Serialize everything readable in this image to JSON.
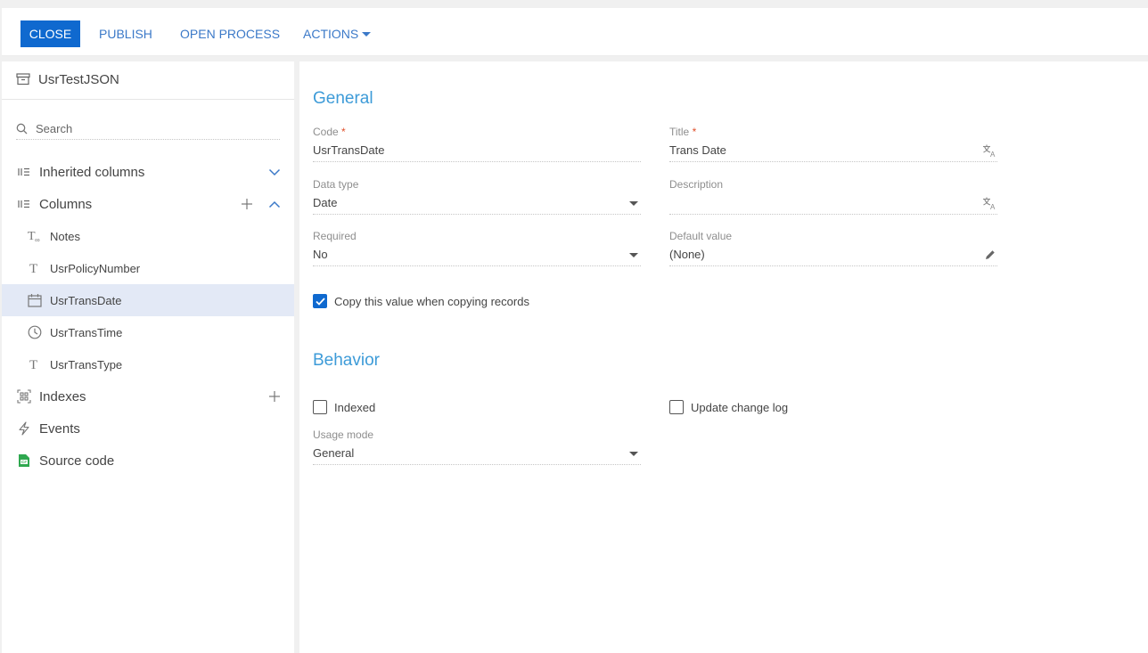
{
  "toolbar": {
    "close": "CLOSE",
    "publish": "PUBLISH",
    "open_process": "OPEN PROCESS",
    "actions": "ACTIONS"
  },
  "sidebar": {
    "object_name": "UsrTestJSON",
    "search_placeholder": "Search",
    "inherited_columns": "Inherited columns",
    "columns": "Columns",
    "column_items": [
      {
        "label": "Notes",
        "icon": "text-multiline-icon"
      },
      {
        "label": "UsrPolicyNumber",
        "icon": "text-icon"
      },
      {
        "label": "UsrTransDate",
        "icon": "calendar-icon",
        "selected": true
      },
      {
        "label": "UsrTransTime",
        "icon": "clock-icon"
      },
      {
        "label": "UsrTransType",
        "icon": "text-icon"
      }
    ],
    "indexes": "Indexes",
    "events": "Events",
    "source_code": "Source code"
  },
  "general": {
    "title": "General",
    "code_label": "Code",
    "code_value": "UsrTransDate",
    "title_label": "Title",
    "title_value": "Trans Date",
    "data_type_label": "Data type",
    "data_type_value": "Date",
    "description_label": "Description",
    "description_value": "",
    "required_label": "Required",
    "required_value": "No",
    "default_value_label": "Default value",
    "default_value_value": "(None)",
    "copy_label": "Copy this value when copying records",
    "copy_checked": true,
    "required_marker": "*"
  },
  "behavior": {
    "title": "Behavior",
    "indexed_label": "Indexed",
    "indexed_checked": false,
    "update_log_label": "Update change log",
    "update_log_checked": false,
    "usage_mode_label": "Usage mode",
    "usage_mode_value": "General"
  },
  "colors": {
    "accent": "#0f69cf",
    "link": "#3b79c8",
    "section_title": "#3d9bd8",
    "required": "#e0502b",
    "selected_row": "#e3e9f6",
    "source_code_icon": "#2fa84f"
  }
}
